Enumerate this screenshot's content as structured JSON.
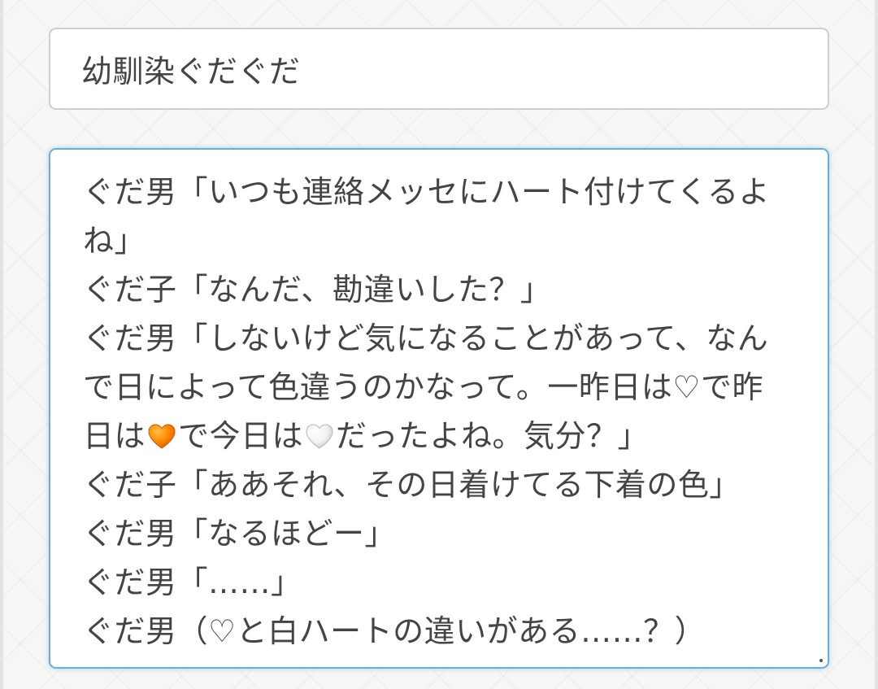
{
  "title_field": {
    "value": "幼馴染ぐだぐだ"
  },
  "body_field": {
    "lines": [
      [
        {
          "t": "ぐだ男「いつも連絡メッセにハート付けてくるよ"
        }
      ],
      [
        {
          "t": "ね」"
        }
      ],
      [
        {
          "t": "ぐだ子「なんだ、勘違いした？」"
        }
      ],
      [
        {
          "t": "ぐだ男「しないけど気になることがあって、なん"
        }
      ],
      [
        {
          "t": "で日によって色違うのかなって。一昨日は♡で昨"
        }
      ],
      [
        {
          "t": "日は"
        },
        {
          "emoji": "orange-heart"
        },
        {
          "t": "で今日は"
        },
        {
          "emoji": "white-heart"
        },
        {
          "t": "だったよね。気分？」"
        }
      ],
      [
        {
          "t": "ぐだ子「ああそれ、その日着けてる下着の色」"
        }
      ],
      [
        {
          "t": "ぐだ男「なるほどー」"
        }
      ],
      [
        {
          "t": "ぐだ男「……」"
        }
      ],
      [
        {
          "t": "ぐだ男（♡と白ハートの違いがある……？）"
        }
      ]
    ]
  },
  "colors": {
    "focus_border": "#6aaed6",
    "input_border": "#cfcfcf",
    "text": "#444444",
    "orange_heart": "#ff8a00",
    "white_heart": "#f2f2f2"
  }
}
